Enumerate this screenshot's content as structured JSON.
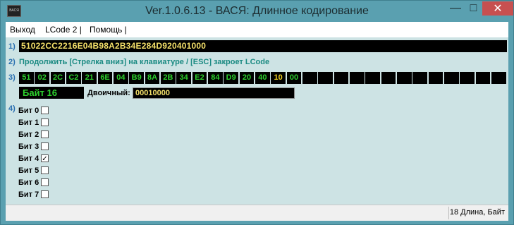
{
  "window": {
    "title": "Ver.1.0.6.13 - ВАСЯ: Длинное кодирование",
    "icon_label": "ВАСЯ",
    "min_glyph": "—",
    "max_glyph": "□",
    "close_glyph": "✕"
  },
  "menu": {
    "items": [
      "Выход",
      "LCode 2 |",
      "Помощь |"
    ]
  },
  "steps": {
    "n1": "1)",
    "n2": "2)",
    "n3": "3)",
    "n4": "4)"
  },
  "code": {
    "value": "51022CC2216E04B98A2B34E284D920401000"
  },
  "hint": "Продолжить [Стрелка вниз] на клавиатуре / [ESC] закроет LCode",
  "bytes": [
    "51",
    "02",
    "2C",
    "C2",
    "21",
    "6E",
    "04",
    "B9",
    "8A",
    "2B",
    "34",
    "E2",
    "84",
    "D9",
    "20",
    "40",
    "10",
    "00",
    "",
    "",
    "",
    "",
    "",
    "",
    "",
    "",
    "",
    "",
    "",
    "",
    ""
  ],
  "selected_byte_index": 16,
  "selected_byte_label": "Байт 16",
  "binary": {
    "label": "Двоичный:",
    "value": "00010000"
  },
  "bits": [
    {
      "label": "Бит 0",
      "checked": false
    },
    {
      "label": "Бит 1",
      "checked": false
    },
    {
      "label": "Бит 2",
      "checked": false
    },
    {
      "label": "Бит 3",
      "checked": false
    },
    {
      "label": "Бит 4",
      "checked": true
    },
    {
      "label": "Бит 5",
      "checked": false
    },
    {
      "label": "Бит 6",
      "checked": false
    },
    {
      "label": "Бит 7",
      "checked": false
    }
  ],
  "status": "18 Длина, Байт"
}
